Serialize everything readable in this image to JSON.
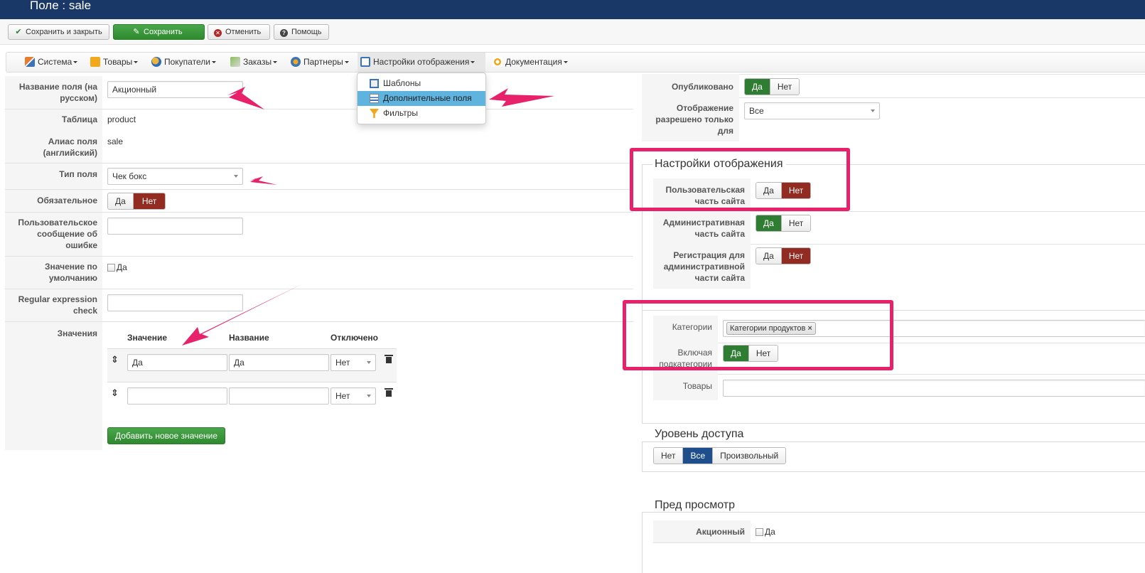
{
  "window": {
    "title": "Поле : sale"
  },
  "toolbar": {
    "save_close": "Сохранить и закрыть",
    "save": "Сохранить",
    "cancel": "Отменить",
    "help": "Помощь"
  },
  "menu": {
    "items": [
      "Система",
      "Товары",
      "Покупатели",
      "Заказы",
      "Партнеры",
      "Настройки отображения",
      "Документация"
    ],
    "dropdown": [
      "Шаблоны",
      "Дополнительные поля",
      "Фильтры"
    ]
  },
  "form": {
    "name_ru_label": "Название поля (на русском)",
    "name_ru_value": "Акционный",
    "table_label": "Таблица",
    "table_value": "product",
    "alias_label": "Алиас поля (английский)",
    "alias_value": "sale",
    "type_label": "Тип поля",
    "type_value": "Чек бокс",
    "required_label": "Обязательное",
    "yes": "Да",
    "no": "Нет",
    "error_msg_label": "Пользовательское сообщение об ошибке",
    "default_label": "Значение по умолчанию",
    "default_option": "Да",
    "regex_label": "Regular expression check",
    "values_label": "Значения",
    "values_headers": [
      "Значение",
      "Название",
      "Отключено"
    ],
    "values_rows": [
      {
        "value": "Да",
        "name": "Да",
        "disabled": "Нет"
      },
      {
        "value": "",
        "name": "",
        "disabled": "Нет"
      }
    ],
    "add_value": "Добавить новое значение"
  },
  "right": {
    "published_label": "Опубликовано",
    "display_only_label": "Отображение разрешено только для",
    "display_only_value": "Все",
    "display_settings_legend": "Настройки отображения",
    "user_part_label": "Пользовательская часть сайта",
    "admin_part_label": "Административная часть сайта",
    "admin_reg_label": "Регистрация для административной части сайта",
    "categories_label": "Категории",
    "categories_tag": "Категории продуктов",
    "include_sub_label": "Включая подкатегории",
    "products_label": "Товары",
    "access_legend": "Уровень доступа",
    "access_options": [
      "Нет",
      "Все",
      "Произвольный"
    ],
    "preview_legend": "Пред просмотр",
    "preview_label": "Акционный",
    "preview_option": "Да"
  },
  "colors": {
    "header_bg": "#1a3867",
    "active_green": "#2f7d32",
    "active_red": "#922b21",
    "active_blue": "#1e4f8c",
    "annotation": "#e8216b",
    "dropdown_highlight": "#5fb3df"
  }
}
